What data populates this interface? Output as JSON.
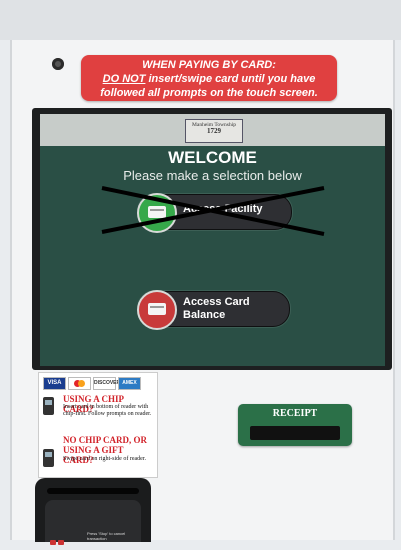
{
  "warning": {
    "line1": "WHEN PAYING BY CARD:",
    "line2_emph": "DO NOT",
    "line2_rest": " insert/swipe card until you have",
    "line3": "followed all prompts on the touch screen."
  },
  "screen": {
    "logo_line1": "Manheim Township",
    "logo_line2": "1729",
    "welcome": "WELCOME",
    "subtitle": "Please make a selection below",
    "buttons": {
      "facility_label": "Access Facility",
      "balance_label_1": "Access Card",
      "balance_label_2": "Balance"
    }
  },
  "decal": {
    "brands": [
      "VISA",
      "DISCOVER",
      "AMEX"
    ],
    "chip_title": "USING A CHIP CARD?",
    "chip_text": "Insert card in bottom of reader with chip-first. Follow prompts on reader.",
    "nochip_title": "NO CHIP CARD, OR USING A GIFT CARD?",
    "nochip_text": "Swipe card on right-side of reader."
  },
  "reader": {
    "label": "Press 'Stop' to cancel transaction"
  },
  "receipt": {
    "label": "RECEIPT"
  },
  "colors": {
    "warning_bg": "#e04040",
    "screen_bg": "#2a4f45",
    "facility_icon": "#36a84a",
    "balance_icon": "#c83a3a",
    "receipt_bg": "#2b7048"
  }
}
